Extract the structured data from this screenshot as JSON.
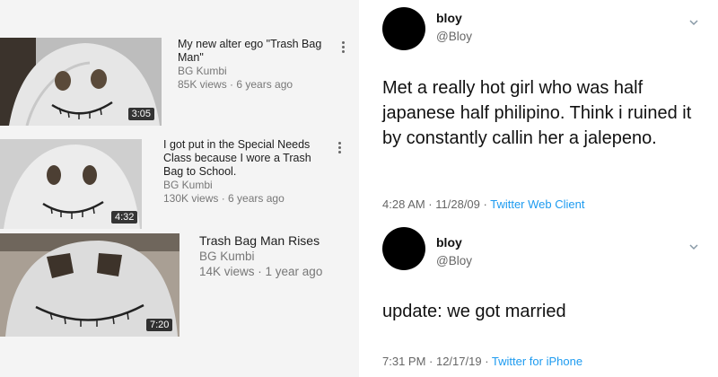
{
  "videos": [
    {
      "title": "My new alter ego \"Trash Bag Man\"",
      "channel": "BG Kumbi",
      "views": "85K views",
      "age": "6 years ago",
      "duration": "3:05"
    },
    {
      "title": "I got put in the Special Needs Class because I wore a Trash Bag to School.",
      "channel": "BG Kumbi",
      "views": "130K views",
      "age": "6 years ago",
      "duration": "4:32"
    },
    {
      "title": "Trash Bag Man Rises",
      "channel": "BG Kumbi",
      "views": "14K views",
      "age": "1 year ago",
      "duration": "7:20"
    }
  ],
  "tweets": [
    {
      "name": "bloy",
      "handle": "@Bloy",
      "text": "Met a really hot girl who was half japanese half philipino. Think i ruined it by constantly callin her a jalepeno.",
      "time": "4:28 AM · 11/28/09",
      "source": "Twitter Web Client"
    },
    {
      "name": "bloy",
      "handle": "@Bloy",
      "text": "update: we got married",
      "time": "7:31 PM · 12/17/19",
      "source": "Twitter for iPhone"
    }
  ],
  "separator": " · ",
  "colors": {
    "link": "#1d9bf0",
    "avatar": "#000000"
  },
  "icons": {
    "menu": "kebab-menu-icon",
    "caret": "chevron-down-icon"
  }
}
